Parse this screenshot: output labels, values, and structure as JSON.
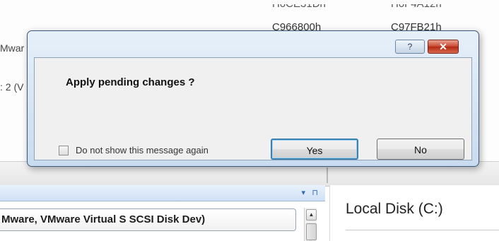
{
  "background": {
    "hex_top_partial": [
      "H0CE31Dh",
      "H0F4A12h"
    ],
    "hex_row": [
      "C966800h",
      "C97FB21h"
    ],
    "left_labels": [
      "Mwar",
      ": 2 (V"
    ]
  },
  "dialog": {
    "message": "Apply pending changes ?",
    "help_glyph": "?",
    "close_glyph": "✕",
    "checkbox_label": "Do not show this message again",
    "checkbox_checked": false,
    "yes_label": "Yes",
    "no_label": "No"
  },
  "left_panel": {
    "pin_glyph": "▾",
    "dock_glyph": "⊓",
    "disk_entry": "Mware, VMware Virtual S SCSI Disk Dev)"
  },
  "right_panel": {
    "title": "Local Disk (C:)"
  },
  "colors": {
    "dialog_frame": "#c9dbef",
    "accent_button_border": "#3c7fb1",
    "close_button": "#c7452d"
  }
}
